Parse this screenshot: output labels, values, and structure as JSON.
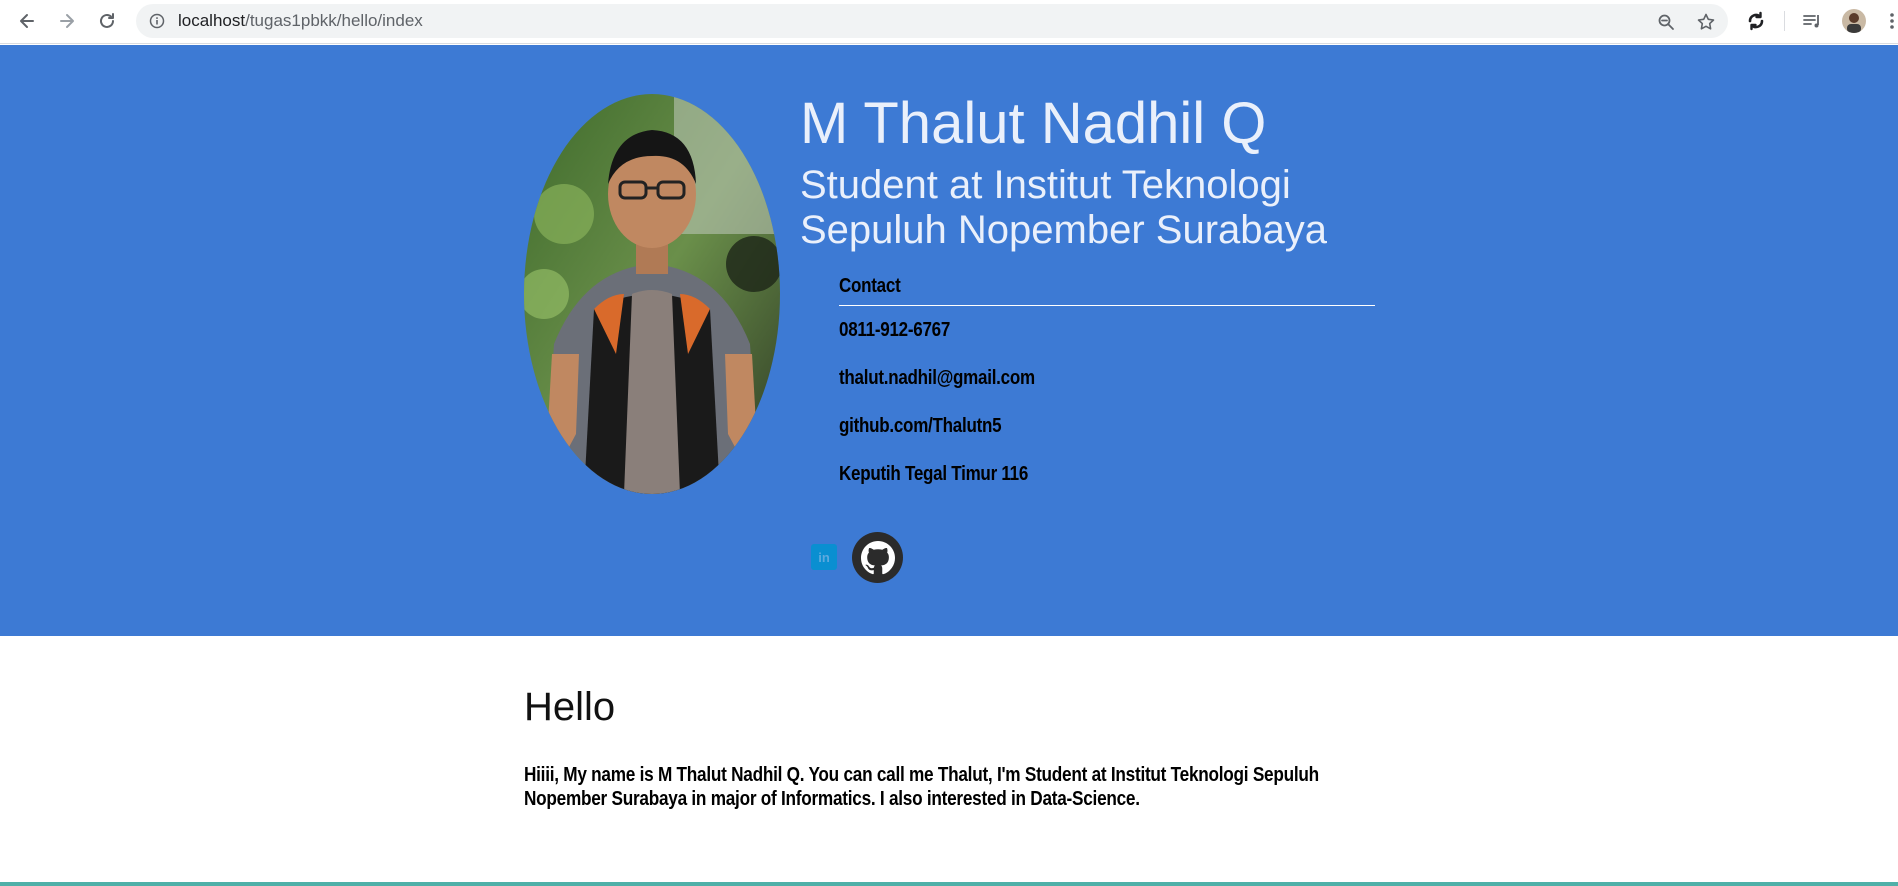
{
  "browser": {
    "url_host": "localhost",
    "url_path": "/tugas1pbkk/hello/index"
  },
  "profile": {
    "name": "M Thalut Nadhil Q",
    "subtitle": "Student at Institut Teknologi Sepuluh Nopember Surabaya",
    "contact_title": "Contact",
    "phone": "0811-912-6767",
    "email": "thalut.nadhil@gmail.com",
    "github": "github.com/Thalutn5",
    "address": "Keputih Tegal Timur 116"
  },
  "content": {
    "heading": "Hello",
    "bio": "Hiiii, My name is M Thalut Nadhil Q. You can call me Thalut, I'm Student at Institut Teknologi Sepuluh Nopember Surabaya in major of Informatics. I also interested in Data-Science."
  },
  "colors": {
    "hero_bg": "#3d7ad4",
    "footer_bar": "#4fb0a8",
    "linkedin": "#0a8fd1",
    "github_circle": "#2b2b2b"
  },
  "icons": {
    "back": "arrow-left-icon",
    "forward": "arrow-right-icon",
    "reload": "reload-icon",
    "site_info": "info-icon",
    "zoom": "zoom-icon",
    "bookmark": "star-icon",
    "extension": "sync-icon",
    "media": "media-queue-icon",
    "menu": "more-vert-icon",
    "linkedin": "linkedin-icon",
    "github": "github-icon"
  }
}
